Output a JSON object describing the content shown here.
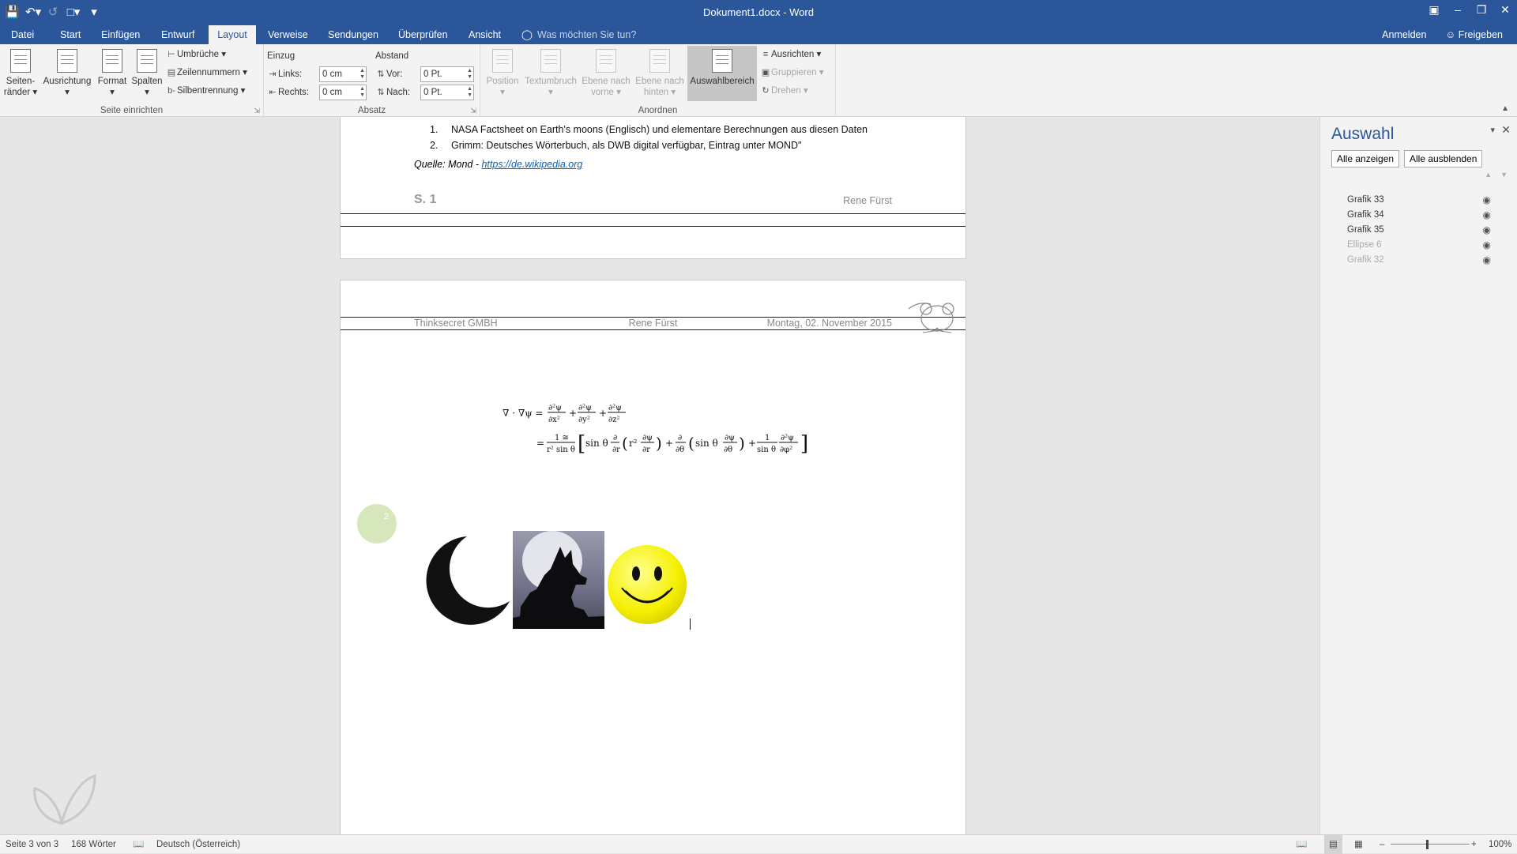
{
  "window": {
    "title": "Dokument1.docx - Word"
  },
  "qat": {
    "save_icon": "save-icon",
    "undo_icon": "undo-icon",
    "redo_icon": "redo-icon",
    "customize_icon": "customize-icon"
  },
  "tabs": [
    {
      "label": "Datei"
    },
    {
      "label": "Start"
    },
    {
      "label": "Einfügen"
    },
    {
      "label": "Entwurf"
    },
    {
      "label": "Layout"
    },
    {
      "label": "Verweise"
    },
    {
      "label": "Sendungen"
    },
    {
      "label": "Überprüfen"
    },
    {
      "label": "Ansicht"
    }
  ],
  "tell_me": "Was möchten Sie tun?",
  "account": {
    "signin": "Anmelden",
    "share": "Freigeben"
  },
  "ribbon": {
    "seite": {
      "label": "Seite einrichten",
      "seitenraender_1": "Seiten-",
      "seitenraender_2": "ränder",
      "ausrichtung": "Ausrichtung",
      "format": "Format",
      "spalten": "Spalten",
      "umbrueche": "Umbrüche",
      "zeilennummern": "Zeilennummern",
      "silbentrennung": "Silbentrennung"
    },
    "absatz": {
      "label": "Absatz",
      "einzug": "Einzug",
      "abstand": "Abstand",
      "links_label": "Links:",
      "links_value": "0 cm",
      "rechts_label": "Rechts:",
      "rechts_value": "0 cm",
      "vor_label": "Vor:",
      "vor_value": "0 Pt.",
      "nach_label": "Nach:",
      "nach_value": "0 Pt."
    },
    "anordnen": {
      "label": "Anordnen",
      "position": "Position",
      "textumbruch": "Textumbruch",
      "ebene_vorne_1": "Ebene nach",
      "ebene_vorne_2": "vorne",
      "ebene_hinten_1": "Ebene nach",
      "ebene_hinten_2": "hinten",
      "auswahlbereich": "Auswahlbereich",
      "ausrichten": "Ausrichten",
      "gruppieren": "Gruppieren",
      "drehen": "Drehen"
    }
  },
  "page1": {
    "list": [
      {
        "num": "1.",
        "text": "NASA Factsheet on Earth's moons (Englisch) und elementare Berechnungen aus diesen Daten"
      },
      {
        "num": "2.",
        "text": "Grimm: Deutsches Wörterbuch, als DWB digital verfügbar, Eintrag unter MOND\""
      }
    ],
    "quelle_prefix": "Quelle: Mond - ",
    "quelle_link": "https://de.wikipedia.org",
    "footer_page": "S. 1",
    "footer_author": "Rene Fürst"
  },
  "page2": {
    "header_company": "Thinksecret GMBH",
    "header_author": "Rene Fürst",
    "header_date": "Montag, 02. November 2015",
    "ellipse_label": "2",
    "eq_lhs": "∇ · ∇ψ =",
    "eq_eq2": "="
  },
  "pane": {
    "title": "Auswahl",
    "show_all": "Alle anzeigen",
    "hide_all": "Alle ausblenden",
    "items": [
      {
        "label": "Grafik 33",
        "hidden": false
      },
      {
        "label": "Grafik 34",
        "hidden": false
      },
      {
        "label": "Grafik 35",
        "hidden": false
      },
      {
        "label": "Ellipse 6",
        "hidden": true
      },
      {
        "label": "Grafik 32",
        "hidden": true
      }
    ]
  },
  "statusbar": {
    "page": "Seite 3 von 3",
    "words": "168 Wörter",
    "language": "Deutsch (Österreich)",
    "zoom": "100%"
  },
  "colors": {
    "accent": "#2b579a",
    "link": "#0563c1",
    "smiley": "#f5f000",
    "ellipse": "#cfe3b0"
  }
}
